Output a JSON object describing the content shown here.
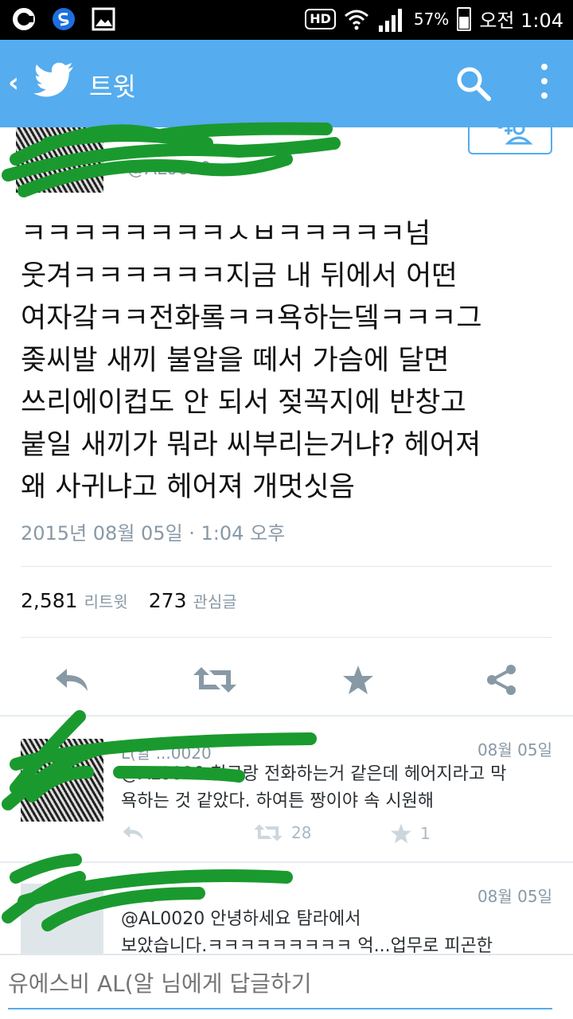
{
  "status_bar": {
    "battery": "57%",
    "time": "오전 1:04",
    "hd": "HD"
  },
  "top_bar": {
    "back": "‹",
    "title": "트윗"
  },
  "tweet": {
    "handle_partial": "@AL0020",
    "text": "ㅋㅋㅋㅋㅋㅋㅋㅋㅅㅂㅋㅋㅋㅋㅋ넘\n웃겨ㅋㅋㅋㅋㅋㅋ지금 내 뒤에서 어떤\n여자갘ㅋㅋ전화롴ㅋㅋ욕하는뎈ㅋㅋㅋ그\n좆씨발 새끼 불알을 떼서 가슴에 달면\n쓰리에이컵도 안 되서 젖꼭지에 반창고\n붙일 새끼가 뭐라 씨부리는거냐? 헤어져\n왜 사귀냐고 헤어져 개멋싯음",
    "date": "2015년 08월 05일 · 1:04 오후",
    "retweets": "2,581",
    "retweets_label": "리트윗",
    "likes": "273",
    "likes_label": "관심글"
  },
  "replies": [
    {
      "name_partial": "L(알 ...0020",
      "date": "08월 05일",
      "text": "@AL0020 친구랑 전화하는거 같은데 헤어지라고 막\n욕하는 것 같았다. 하여튼 짱이야 속 시원해",
      "retweets": "28",
      "likes": "1"
    },
    {
      "name_partial": "...08",
      "date": "08월 05일",
      "text": "@AL0020  안녕하세요 탐라에서\n보았습니다.ㅋㅋㅋㅋㅋㅋㅋㅋㅋ 억...업무로 피곤한"
    }
  ],
  "composer": {
    "placeholder": "유에스비 AL(알 님에게 답글하기"
  },
  "colors": {
    "brand": "#55acee",
    "scribble": "#1a9a2e",
    "muted": "#8899a6"
  }
}
